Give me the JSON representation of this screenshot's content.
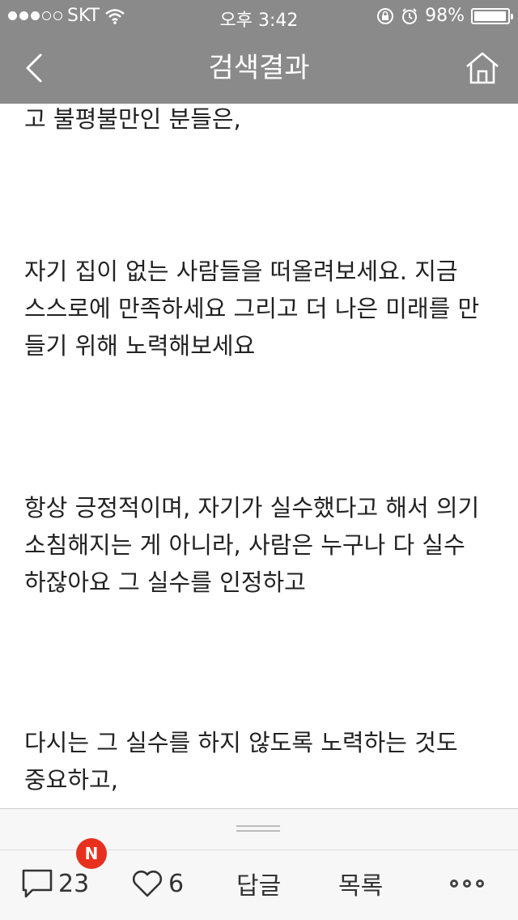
{
  "status_bar": {
    "carrier": "SKT",
    "time": "오후 3:42",
    "battery": "98%",
    "battery_level": 0.98
  },
  "nav": {
    "title": "검색결과",
    "back_icon": "chevron-left-icon",
    "home_icon": "home-icon"
  },
  "article": {
    "paragraphs": [
      "고 불평불만인 분들은,",
      "자기 집이 없는 사람들을 떠올려보세요. 지금 스스로에 만족하세요 그리고 더 나은 미래를 만들기 위해 노력해보세요",
      "항상 긍정적이며, 자기가 실수했다고 해서 의기소침해지는 게 아니라, 사람은 누구나 다 실수하잖아요 그 실수를 인정하고",
      "다시는 그 실수를 하지 않도록 노력하는 것도 중요하고,"
    ]
  },
  "toolbar": {
    "badge": "N",
    "comment_count": "23",
    "like_count": "6",
    "reply_label": "답글",
    "list_label": "목록"
  }
}
